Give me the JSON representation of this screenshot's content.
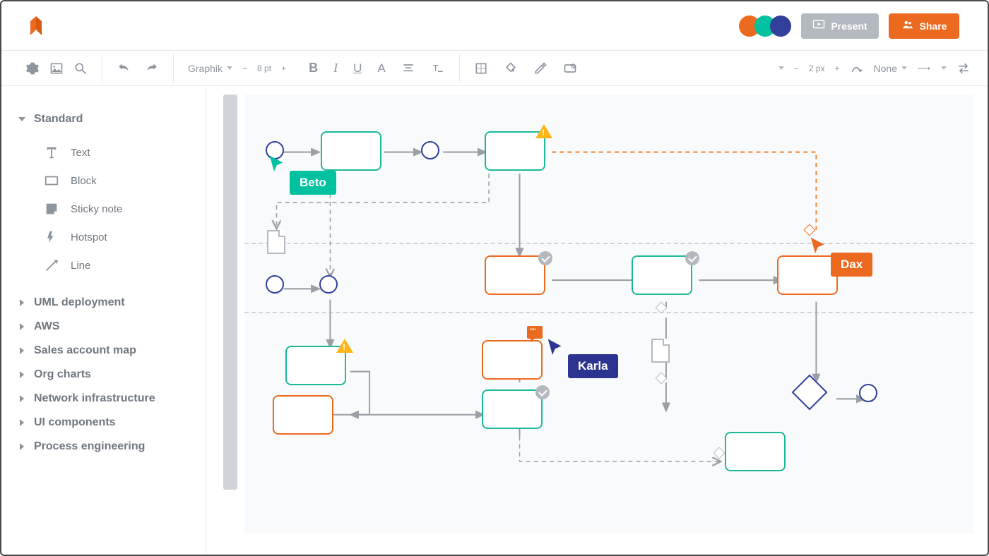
{
  "header": {
    "present_label": "Present",
    "share_label": "Share",
    "avatars": [
      {
        "color": "#ec6a1f"
      },
      {
        "color": "#00c2a0"
      },
      {
        "color": "#323f9b"
      }
    ]
  },
  "toolbar": {
    "font_family": "Graphik",
    "font_size": "8 pt",
    "stroke_width": "2 px",
    "line_style": "None"
  },
  "sidebar": {
    "sections": [
      {
        "label": "Standard",
        "open": true,
        "items": [
          {
            "label": "Text",
            "icon": "text"
          },
          {
            "label": "Block",
            "icon": "block"
          },
          {
            "label": "Sticky note",
            "icon": "sticky"
          },
          {
            "label": "Hotspot",
            "icon": "hotspot"
          },
          {
            "label": "Line",
            "icon": "line"
          }
        ]
      },
      {
        "label": "UML deployment",
        "open": false
      },
      {
        "label": "AWS",
        "open": false
      },
      {
        "label": "Sales account map",
        "open": false
      },
      {
        "label": "Org charts",
        "open": false
      },
      {
        "label": "Network infrastructure",
        "open": false
      },
      {
        "label": "UI components",
        "open": false
      },
      {
        "label": "Process engineering",
        "open": false
      }
    ]
  },
  "canvas": {
    "collaborators": [
      {
        "name": "Beto",
        "color": "teal"
      },
      {
        "name": "Karla",
        "color": "navy"
      },
      {
        "name": "Dax",
        "color": "orange"
      }
    ]
  }
}
